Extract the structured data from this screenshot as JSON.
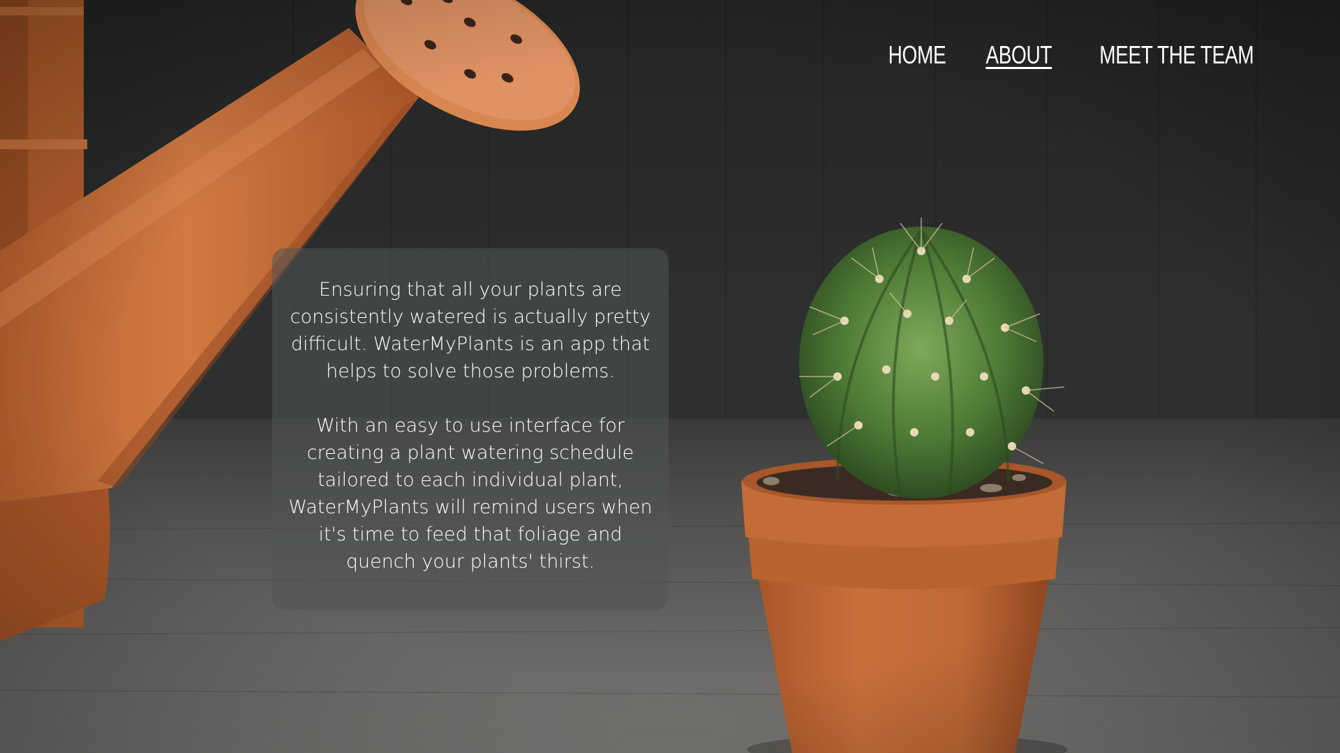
{
  "nav": {
    "items": [
      {
        "label": "HOME",
        "active": false
      },
      {
        "label": "ABOUT",
        "active": true
      },
      {
        "label": "MEET THE TEAM",
        "active": false
      }
    ]
  },
  "about": {
    "paragraph_1": "Ensuring that all your plants are consistently watered is actually pretty difficult. WaterMyPlants is an app that helps to solve those problems.",
    "paragraph_2": "With an easy to use interface for creating a plant watering schedule tailored to each individual plant, WaterMyPlants will remind users when it's time to feed that foliage and quench your plants' thirst."
  },
  "colors": {
    "terracotta": "#c8703a",
    "nav_text": "#ffffff",
    "card_bg": "#505556"
  }
}
